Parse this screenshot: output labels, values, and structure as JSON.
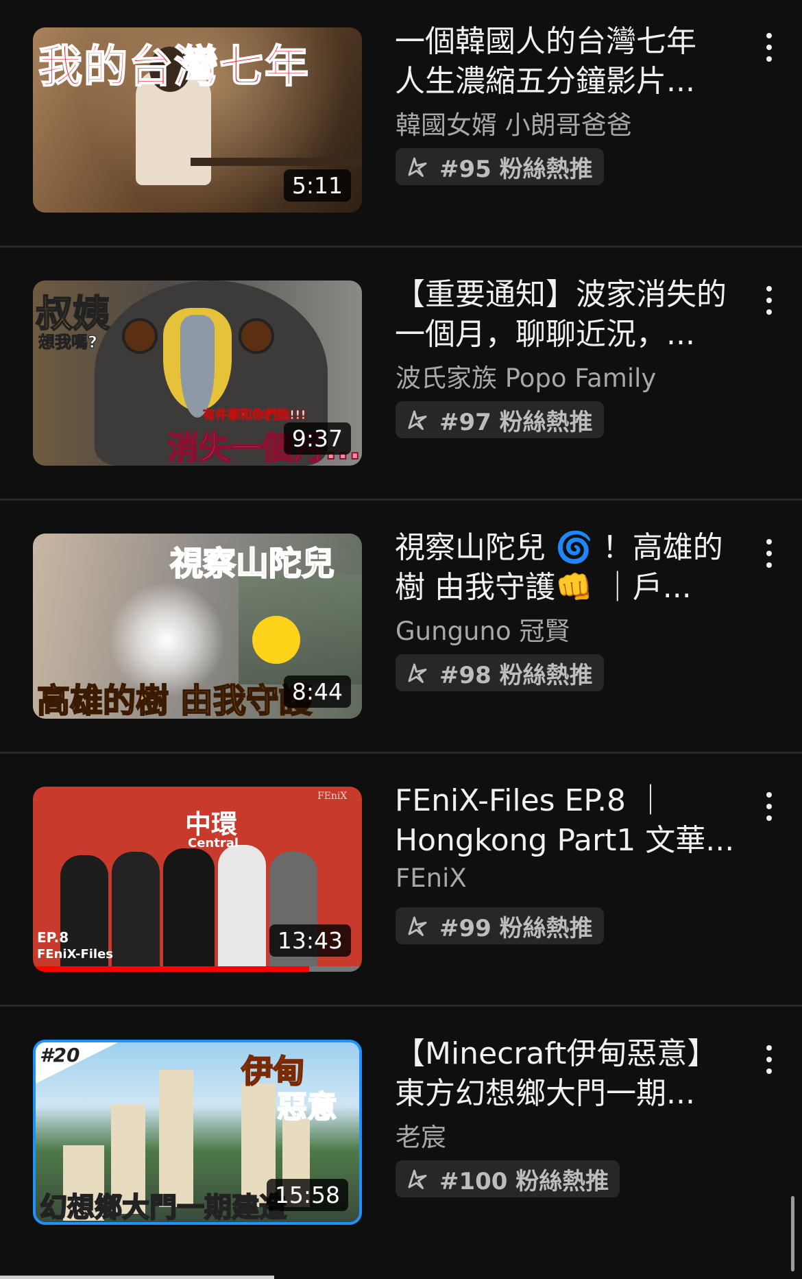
{
  "videos": [
    {
      "title": "一個韓國人的台灣七年\n人生濃縮五分鐘影片...",
      "channel": "韓國女婿 小朗哥爸爸",
      "badge": "#95 粉絲熱推",
      "duration": "5:11",
      "thumb_overlay": [
        "我的台灣七年"
      ]
    },
    {
      "title": "【重要通知】波家消失的\n一個月，聊聊近況，...",
      "channel": "波氏家族 Popo Family",
      "badge": "#97 粉絲熱推",
      "duration": "9:37",
      "thumb_overlay": [
        "叔姨",
        "想我嗎?",
        "有件事和你們說!!!",
        "消失一個月...?"
      ]
    },
    {
      "title": "視察山陀兒 🌀 ！高雄的\n樹 由我守護👊 ｜戶...",
      "channel": "Gunguno 冠賢",
      "badge": "#98 粉絲熱推",
      "duration": "8:44",
      "thumb_overlay": [
        "視察山陀兒",
        "高雄的樹 由我守護"
      ]
    },
    {
      "title": "FEniX-Files EP.8 ｜\nHongkong Part1 文華...",
      "channel": "FEniX",
      "badge": "#99 粉絲熱推",
      "duration": "13:43",
      "thumb_overlay": [
        "中環",
        "Central",
        "FEniX",
        "EP.8",
        "FEniX-Files"
      ]
    },
    {
      "title": "【Minecraft伊甸惡意】\n東方幻想鄉大門一期...",
      "channel": "老宸",
      "badge": "#100 粉絲熱推",
      "duration": "15:58",
      "thumb_overlay": [
        "#20",
        "伊甸",
        "惡意",
        "幻想鄉大門一期建造"
      ]
    }
  ],
  "colors": {
    "background": "#0f0f0f",
    "text_primary": "#f1f1f1",
    "text_secondary": "#a8a8a8",
    "badge_bg": "#272727"
  },
  "icons": {
    "badge": "trending-star-icon",
    "menu": "more-vert-icon"
  }
}
